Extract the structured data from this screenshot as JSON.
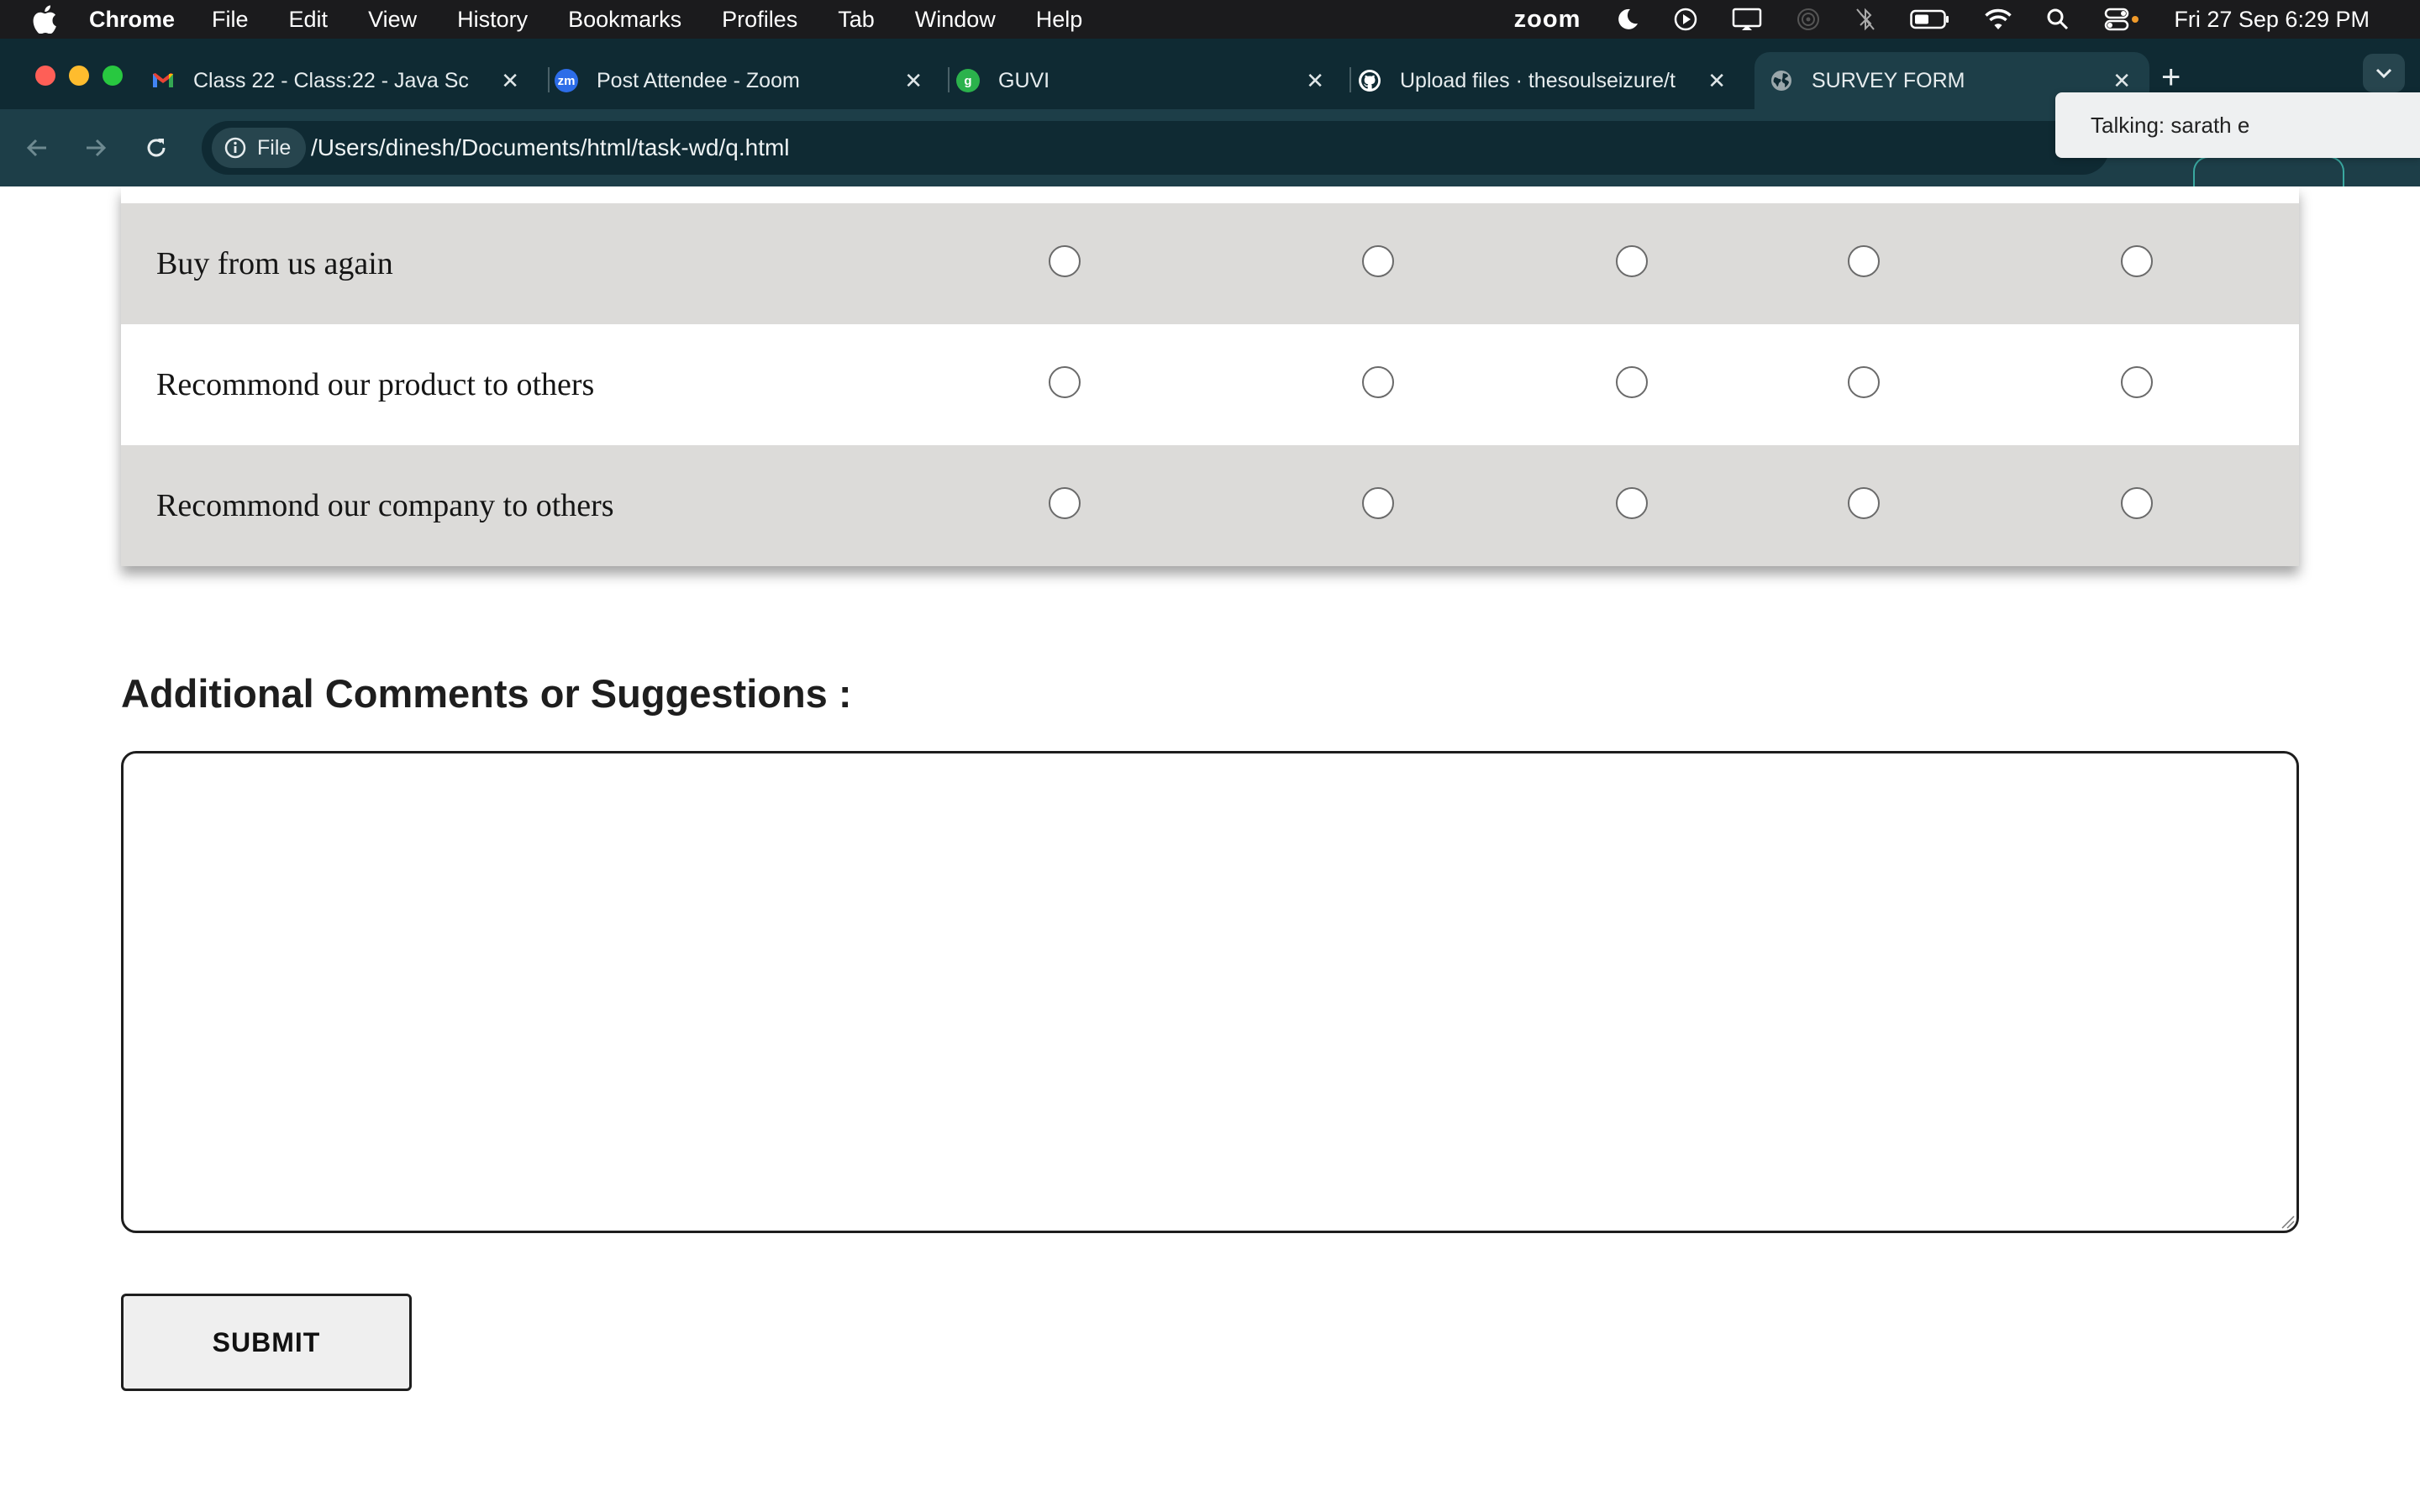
{
  "menubar": {
    "app_name": "Chrome",
    "items": [
      "File",
      "Edit",
      "View",
      "History",
      "Bookmarks",
      "Profiles",
      "Tab",
      "Window",
      "Help"
    ],
    "status": {
      "zoom": "zoom",
      "clock": "Fri 27 Sep  6:29 PM"
    }
  },
  "tabs": [
    {
      "title": "Class 22 - Class:22 - Java Sc",
      "icon": "gmail-icon"
    },
    {
      "title": "Post Attendee - Zoom",
      "icon": "zoom-icon",
      "icon_text": "zm"
    },
    {
      "title": "GUVI",
      "icon": "guvi-icon",
      "icon_text": "g"
    },
    {
      "title": "Upload files · thesoulseizure/t",
      "icon": "github-icon"
    },
    {
      "title": "SURVEY FORM",
      "icon": "globe-icon",
      "active": true
    }
  ],
  "toolbar": {
    "chip_label": "File",
    "url": "/Users/dinesh/Documents/html/task-wd/q.html"
  },
  "zoom_popup": {
    "text": "Talking: sarath e"
  },
  "survey": {
    "rows": [
      {
        "label": "Buy from us again",
        "shaded": true
      },
      {
        "label": "Recommond our product to others",
        "shaded": false
      },
      {
        "label": "Recommond our company to others",
        "shaded": true
      }
    ],
    "options_per_row": 5
  },
  "comments": {
    "heading": "Additional Comments or Suggestions :",
    "value": ""
  },
  "submit": {
    "label": "SUBMIT"
  },
  "colors": {
    "menubar_bg": "#1b1b1d",
    "tabstrip_bg": "#0f2a33",
    "toolbar_bg": "#1d3e48",
    "row_shade": "#dcdbd9"
  }
}
